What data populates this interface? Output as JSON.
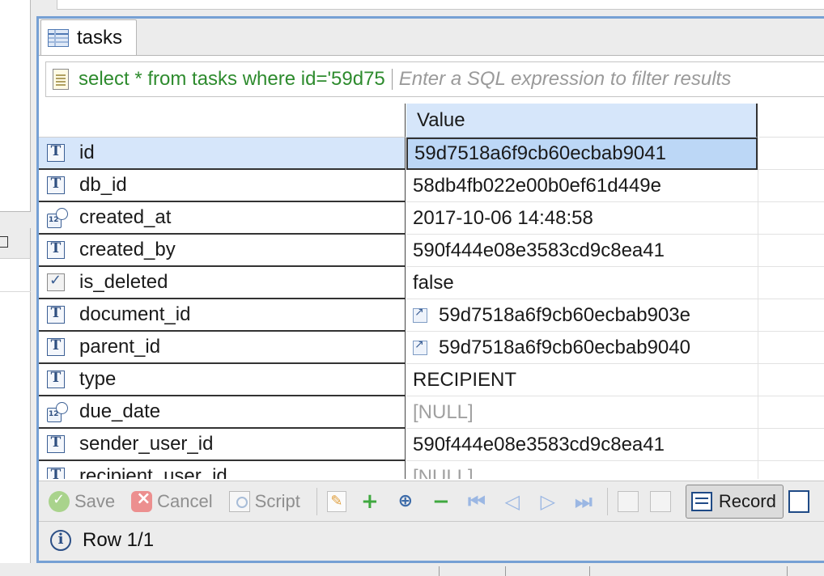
{
  "tab": {
    "label": "tasks"
  },
  "filter": {
    "query": "select * from tasks where id='59d75",
    "placeholder": "Enter a SQL expression to filter results"
  },
  "grid": {
    "value_header": "Value",
    "rows": [
      {
        "name": "id",
        "type": "text",
        "value": "59d7518a6f9cb60ecbab9041",
        "selected": true
      },
      {
        "name": "db_id",
        "type": "text",
        "value": "58db4fb022e00b0ef61d449e"
      },
      {
        "name": "created_at",
        "type": "datetime",
        "value": "2017-10-06 14:48:58"
      },
      {
        "name": "created_by",
        "type": "text",
        "value": "590f444e08e3583cd9c8ea41"
      },
      {
        "name": "is_deleted",
        "type": "boolean",
        "value": "false"
      },
      {
        "name": "document_id",
        "type": "text",
        "value": "59d7518a6f9cb60ecbab903e",
        "link": true
      },
      {
        "name": "parent_id",
        "type": "text",
        "value": "59d7518a6f9cb60ecbab9040",
        "link": true
      },
      {
        "name": "type",
        "type": "text",
        "value": "RECIPIENT"
      },
      {
        "name": "due_date",
        "type": "datetime",
        "value": "[NULL]",
        "null": true
      },
      {
        "name": "sender_user_id",
        "type": "text",
        "value": "590f444e08e3583cd9c8ea41"
      },
      {
        "name": "recipient_user_id",
        "type": "text",
        "value": "[NULL]",
        "null": true
      }
    ]
  },
  "toolbar": {
    "save_label": "Save",
    "cancel_label": "Cancel",
    "script_label": "Script",
    "record_label": "Record"
  },
  "status": {
    "text": "Row 1/1"
  },
  "colors": {
    "accent": "#76a0d4",
    "selection": "#bcd7f6",
    "header": "#d6e6fa",
    "query_text": "#2e8b2e"
  },
  "icons": {
    "text_type": "text-type-icon",
    "datetime_type": "datetime-type-icon",
    "boolean_type": "boolean-type-icon",
    "link": "link-icon"
  }
}
